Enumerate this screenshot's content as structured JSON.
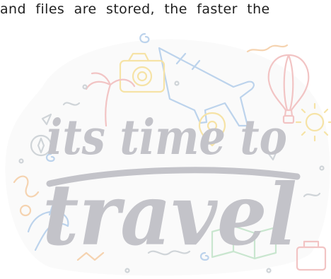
{
  "document": {
    "text_line": "and files are stored, the faster the"
  },
  "illustration": {
    "lettering_line1": "its time to",
    "lettering_line2": "travel",
    "colors": {
      "lettering": "#c3c3c9",
      "doodle_blue": "#bcd3ec",
      "doodle_yellow": "#f6e3a6",
      "doodle_pink": "#f2c4c4",
      "doodle_orange": "#f5d3b0",
      "doodle_green": "#c9e6cf",
      "doodle_grey": "#cfd4d8"
    },
    "icons": [
      "airplane-icon",
      "camera-icon",
      "hot-air-balloon-icon",
      "location-pin-icon",
      "palm-tree-icon",
      "sun-icon",
      "suitcase-icon",
      "map-icon",
      "dolphin-icon",
      "compass-icon"
    ]
  }
}
